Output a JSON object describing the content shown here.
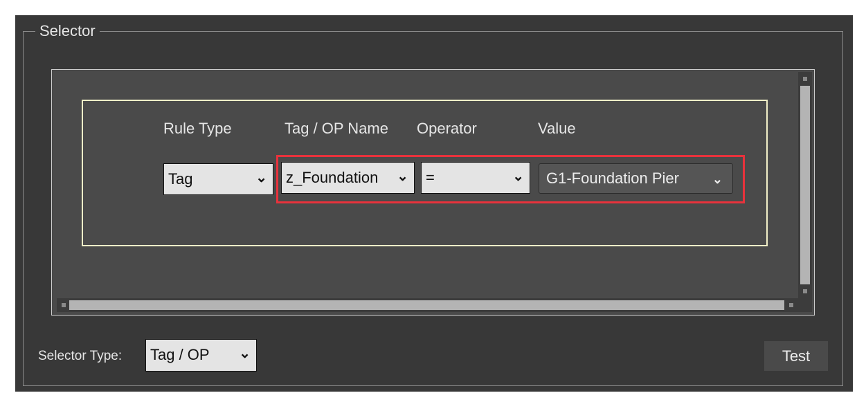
{
  "group": {
    "title": "Selector"
  },
  "headers": {
    "rule_type": "Rule Type",
    "tag_op_name": "Tag / OP Name",
    "operator": "Operator",
    "value": "Value"
  },
  "rule": {
    "rule_type": "Tag",
    "tag_op_name": "z_Foundation",
    "operator": "=",
    "value": "G1-Foundation Pier"
  },
  "footer": {
    "selector_type_label": "Selector Type:",
    "selector_type_value": "Tag / OP",
    "test_label": "Test"
  },
  "colors": {
    "highlight": "#e8323c",
    "rule_border": "#f2f0c8",
    "panel": "#383838"
  },
  "icons": {
    "dropdown": "chevron-down-icon"
  }
}
